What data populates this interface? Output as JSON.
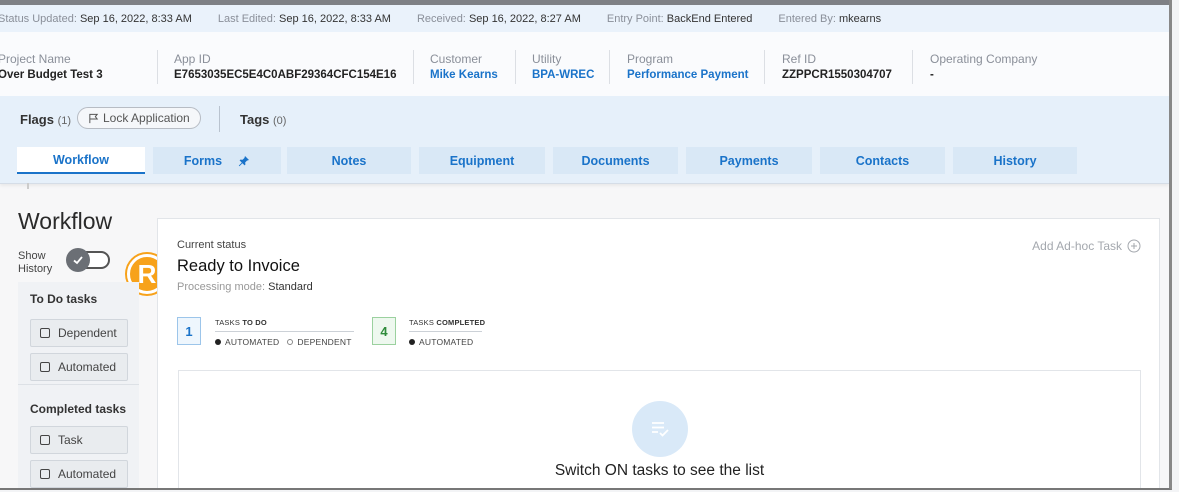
{
  "status_bar": {
    "updated_label": "Status Updated:",
    "updated_value": "Sep 16, 2022, 8:33 AM",
    "edited_label": "Last Edited:",
    "edited_value": "Sep 16, 2022, 8:33 AM",
    "received_label": "Received:",
    "received_value": "Sep 16, 2022, 8:27 AM",
    "entry_label": "Entry Point:",
    "entry_value": "BackEnd Entered",
    "entered_label": "Entered By:",
    "entered_value": "mkearns"
  },
  "meta": {
    "project_name_label": "Project Name",
    "project_name": "Over Budget Test 3",
    "app_id_label": "App ID",
    "app_id": "E7653035EC5E4C0ABF29364CFC154E16",
    "customer_label": "Customer",
    "customer": "Mike Kearns",
    "utility_label": "Utility",
    "utility": "BPA-WREC",
    "program_label": "Program",
    "program": "Performance Payment",
    "ref_id_label": "Ref ID",
    "ref_id": "ZZPPCR1550304707",
    "operating_company_label": "Operating Company",
    "operating_company": "-"
  },
  "flags": {
    "label": "Flags",
    "count": "(1)",
    "lock_button": "Lock Application",
    "tags_label": "Tags",
    "tags_count": "(0)"
  },
  "tabs": [
    {
      "label": "Workflow",
      "active": true
    },
    {
      "label": "Forms",
      "pinned": true
    },
    {
      "label": "Notes"
    },
    {
      "label": "Equipment"
    },
    {
      "label": "Documents"
    },
    {
      "label": "Payments"
    },
    {
      "label": "Contacts"
    },
    {
      "label": "History"
    }
  ],
  "workflow": {
    "title": "Workflow",
    "show_history_label_1": "Show",
    "show_history_label_2": "History",
    "show_history_on": true,
    "badge_letter": "R",
    "todo_heading": "To Do tasks",
    "todo_buttons": [
      "Dependent",
      "Automated"
    ],
    "completed_heading": "Completed tasks",
    "completed_buttons": [
      "Task",
      "Automated"
    ]
  },
  "status_card": {
    "current_status_label": "Current status",
    "current_status": "Ready to Invoice",
    "processing_mode_label": "Processing mode:",
    "processing_mode": "Standard",
    "add_adhoc": "Add Ad-hoc Task",
    "todo_count": "1",
    "todo_title_a": "TASKS",
    "todo_title_b": "TO DO",
    "todo_legend_1": "AUTOMATED",
    "todo_legend_2": "DEPENDENT",
    "completed_count": "4",
    "completed_title_a": "TASKS",
    "completed_title_b": "COMPLETED",
    "completed_legend_1": "AUTOMATED",
    "empty_message": "Switch ON tasks to see the list"
  },
  "colors": {
    "accent": "#1a73c9",
    "badge": "#f7a21b",
    "completed_green": "#2e8b3a"
  }
}
